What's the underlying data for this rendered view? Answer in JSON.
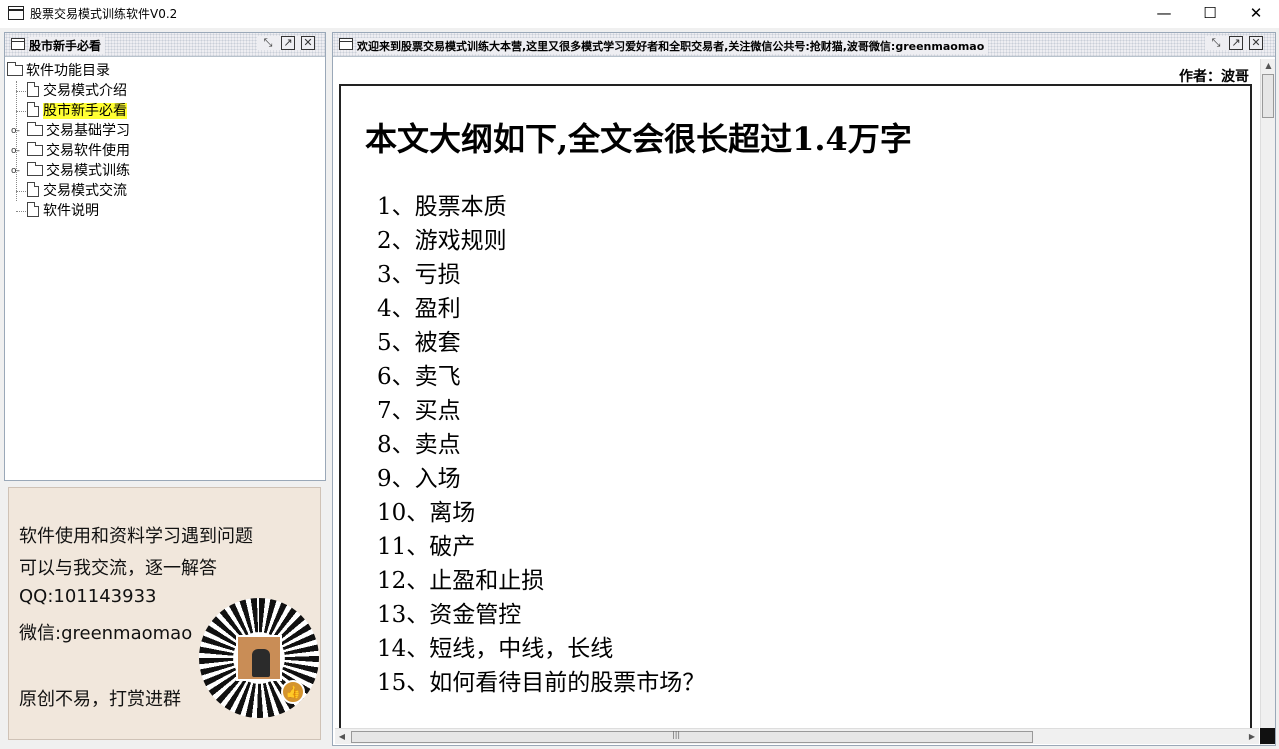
{
  "window": {
    "title": "股票交易模式训练软件V0.2",
    "minimize": "—",
    "maximize": "☐",
    "close": "✕"
  },
  "left_panel": {
    "title": "股市新手必看",
    "tree": {
      "root": "软件功能目录",
      "items": [
        {
          "label": "交易模式介绍",
          "type": "doc",
          "expandable": false,
          "selected": false
        },
        {
          "label": "股市新手必看",
          "type": "doc",
          "expandable": false,
          "selected": true
        },
        {
          "label": "交易基础学习",
          "type": "folder",
          "expandable": true,
          "selected": false
        },
        {
          "label": "交易软件使用",
          "type": "folder",
          "expandable": true,
          "selected": false
        },
        {
          "label": "交易模式训练",
          "type": "folder",
          "expandable": true,
          "selected": false
        },
        {
          "label": "交易模式交流",
          "type": "doc",
          "expandable": false,
          "selected": false
        },
        {
          "label": "软件说明",
          "type": "doc",
          "expandable": false,
          "selected": false
        }
      ]
    }
  },
  "info_box": {
    "line1": "软件使用和资料学习遇到问题",
    "line2": "可以与我交流，逐一解答",
    "qq": "QQ:101143933",
    "wechat": "微信:greenmaomao",
    "line5": "原创不易，打赏进群",
    "selected_color": "#ffff33"
  },
  "right_panel": {
    "title": "欢迎来到股票交易模式训练大本营,这里又很多模式学习爱好者和全职交易者,关注微信公共号:抢财猫,波哥微信:greenmaomao",
    "author": "作者：波哥",
    "heading": "本文大纲如下,全文会很长超过1.4万字",
    "outline": [
      "1、股票本质",
      "2、游戏规则",
      "3、亏损",
      "4、盈利",
      "5、被套",
      "6、卖飞",
      "7、买点",
      "8、卖点",
      "9、入场",
      "10、离场",
      "11、破产",
      "12、止盈和止损",
      "13、资金管控",
      "14、短线，中线，长线",
      "15、如何看待目前的股票市场？"
    ]
  },
  "icons": {
    "minimize_pane": "minimize-pane-icon",
    "maximize_pane": "maximize-pane-icon",
    "close_pane": "close-pane-icon",
    "doc": "document-icon",
    "folder": "folder-icon"
  }
}
